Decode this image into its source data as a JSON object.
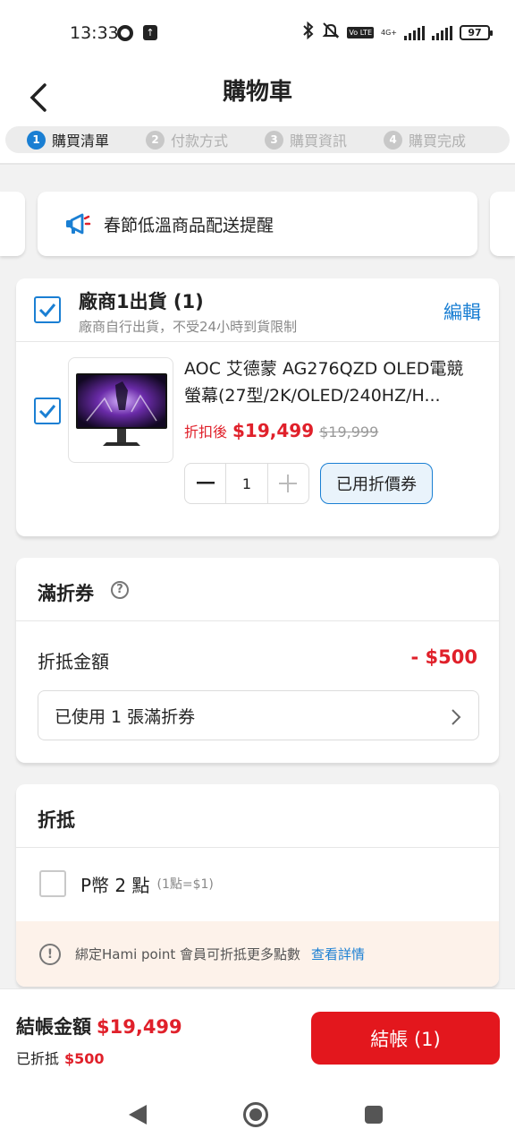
{
  "status_bar": {
    "time": "13:33",
    "network": "4G+",
    "volte": "Vo LTE",
    "battery": "97"
  },
  "header": {
    "title": "購物車"
  },
  "steps": [
    {
      "num": "1",
      "label": "購買清單"
    },
    {
      "num": "2",
      "label": "付款方式"
    },
    {
      "num": "3",
      "label": "購買資訊"
    },
    {
      "num": "4",
      "label": "購買完成"
    }
  ],
  "notice": {
    "text": "春節低溫商品配送提醒",
    "icon": "megaphone-icon"
  },
  "vendor": {
    "title": "廠商1出貨 (1)",
    "subtitle": "廠商自行出貨，不受24小時到貨限制",
    "edit_label": "編輯"
  },
  "product": {
    "name": "AOC 艾德蒙 AG276QZD OLED電競螢幕(27型/2K/OLED/240HZ/H...",
    "price_label": "折扣後",
    "price_now": "$19,499",
    "price_old": "$19,999",
    "quantity": "1",
    "coupon_label": "已用折價券"
  },
  "coupon_section": {
    "title": "滿折券",
    "discount_label": "折抵金額",
    "discount_value": "- $500",
    "used_label": "已使用 1 張滿折券"
  },
  "points_section": {
    "title": "折抵",
    "points_label": "P幣 2 點",
    "points_note": "(1點=$1)",
    "hami_text": "綁定Hami point 會員可折抵更多點數",
    "hami_link": "查看詳情"
  },
  "checkout": {
    "total_label": "結帳金額",
    "total_value": "$19,499",
    "deduct_label": "已折抵",
    "deduct_value": "$500",
    "button_label": "結帳 (1)"
  },
  "colors": {
    "accent_blue": "#1a7fd3",
    "price_red": "#e0202a",
    "checkout_red": "#e3171d"
  }
}
